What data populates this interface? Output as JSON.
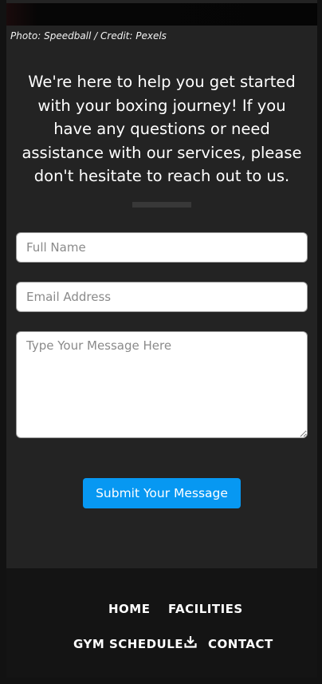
{
  "photo": {
    "credit": "Photo: Speedball / Credit: Pexels"
  },
  "intro": {
    "text": "We're here to help you get started with your boxing journey! If you have any questions or need assistance with our services, please don't hesitate to reach out to us."
  },
  "form": {
    "name_placeholder": "Full Name",
    "email_placeholder": "Email Address",
    "message_placeholder": "Type Your Message Here",
    "submit_label": "Submit Your Message"
  },
  "colors": {
    "accent": "#0798f2",
    "page_background": "#232323",
    "footer_background": "#141414"
  },
  "footer": {
    "nav": [
      {
        "label": "HOME"
      },
      {
        "label": "FACILITIES"
      },
      {
        "label": "GYM SCHEDULE",
        "icon": "download-icon"
      },
      {
        "label": "CONTACT"
      }
    ]
  }
}
